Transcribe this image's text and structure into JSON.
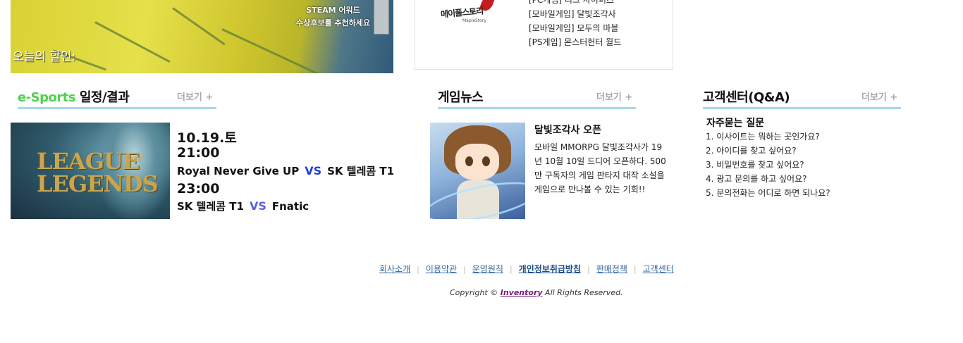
{
  "banner": {
    "steam_line1": "STEAM 어워드",
    "steam_line2": "수상후보를 추천하세요",
    "sale_label": "오늘의 할인:"
  },
  "game_box": {
    "logo_text": "메이플스토리",
    "logo_sub": "MapleStory",
    "items": [
      "[PC게임] 리그 사이퍼즈",
      "[모바일게임] 달빛조각사",
      "[모바일게임] 모두의 마블",
      "[PS게임] 몬스터헌터 월드"
    ]
  },
  "esports": {
    "title_green": "e-Sports",
    "title_rest": " 일정/결과",
    "more_label": "더보기 +",
    "thumb_line1": "LEAGUE",
    "thumb_of": "OF",
    "thumb_line2": "LEGENDS",
    "date": "10.19.토",
    "matches": [
      {
        "time": "21:00",
        "team1": "Royal Never Give UP",
        "vs": "VS",
        "team2": "SK 텔레콤 T1"
      },
      {
        "time": "23:00",
        "team1": "SK 텔레콤 T1",
        "vs": "VS",
        "team2": "Fnatic"
      }
    ]
  },
  "news": {
    "title": "게임뉴스",
    "more_label": "더보기 +",
    "headline": "달빛조각사 오픈",
    "body": "모바일 MMORPG 달빛조각사가 19년 10월 10일 드디어 오픈하다. 500만 구독자의 게임 판타지 대작 소설을 게임으로 만나볼 수 있는 기회!!"
  },
  "customer_center": {
    "title": "고객센터(Q&A)",
    "more_label": "더보기 +",
    "faq_title": "자주묻는 질문",
    "faq": [
      "1. 이사이트는 뭐하는 곳인가요?",
      "2. 아이디를 찾고 싶어요?",
      "3. 비밀번호를 찾고 싶어요?",
      "4. 광고 문의를 하고 싶어요?",
      "5. 문의전화는 어디로 하면 되나요?"
    ]
  },
  "footer": {
    "links": [
      "회사소개",
      "이용약관",
      "운영원칙",
      "개인정보취급방침",
      "판매정책",
      "고객센터"
    ],
    "separator": "|",
    "copyright_prefix": "Copyright © ",
    "brand": "Inventory",
    "copyright_suffix": " All Rights Reserved."
  },
  "colors": {
    "accent_underline": "#a9d6ec",
    "esports_green": "#4ed24e",
    "vs_blue": "#1f3fd6",
    "footer_link": "#3166a3",
    "brand_purple": "#7a1a7a"
  }
}
